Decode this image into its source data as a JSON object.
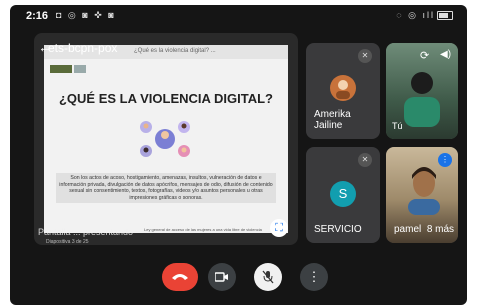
{
  "status_bar": {
    "time": "2:16",
    "left_icons": "◘ ◎ ◙ ✜ ◙",
    "right_icons": "◌ ◎ ıll"
  },
  "presentation": {
    "meeting_code": "ets-bcpn-pox",
    "slide_header": "¿Qué es la violencia digital? ...",
    "slide_title": "¿QUÉ ES LA VIOLENCIA DIGITAL?",
    "slide_body": "Son los actos de acoso, hostigamiento, amenazas, insultos, vulneración de datos e información privada, divulgación de datos apócrifos, mensajes de odio, difusión de contenido sexual sin consentimiento, textos, fotografías, videos y/o asuntos personales u otras impresiones gráficas o sonoras.",
    "slide_footer": "Ley general de acceso de las mujeres a una vida libre de violencia",
    "page_indicator": "Diapositiva 3 de 25",
    "caption": "Pantalla ... presentando",
    "expand_icon": "fullscreen-icon"
  },
  "participants": [
    {
      "name": "Amerika Jailine",
      "initial": "",
      "avatar_color": "#c8723a",
      "muted": true
    },
    {
      "name": "Tú",
      "initial": "",
      "avatar_color": "",
      "muted": false
    },
    {
      "name": "SERVICIO",
      "initial": "S",
      "avatar_color": "#129eaf",
      "muted": true
    },
    {
      "name": "pamel",
      "extra": "8 más",
      "initial": "",
      "avatar_color": "",
      "muted": false
    }
  ],
  "colors": {
    "end_call": "#ea4335",
    "tile_bg": "#3a3a3c",
    "accent": "#1a73e8"
  }
}
